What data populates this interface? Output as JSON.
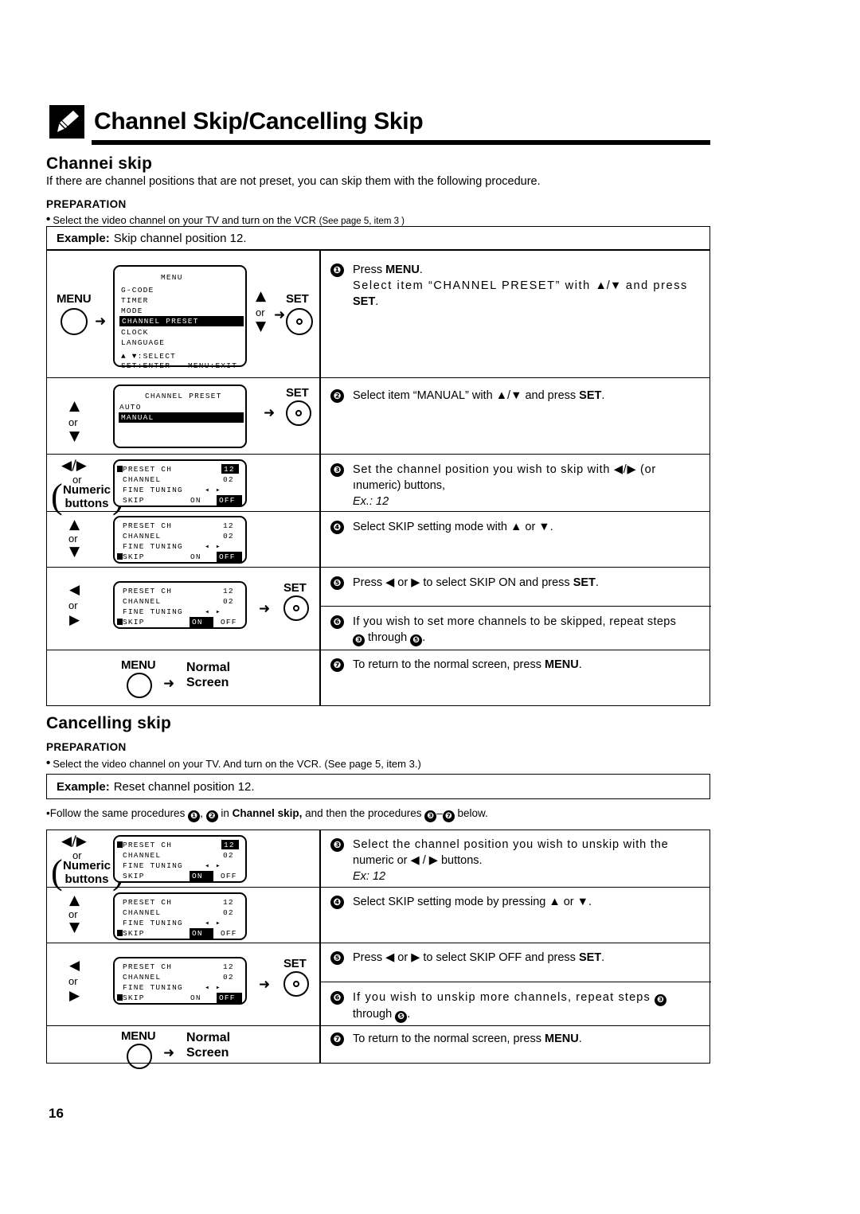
{
  "page": {
    "number": "16",
    "title": "Channel Skip/Cancelling Skip",
    "title_icon": "pen-icon"
  },
  "channel_skip": {
    "heading": "Channei skip",
    "intro": "If there are channel positions that are not preset, you can skip them with the following procedure.",
    "preparation_label": "PREPARATION",
    "preparation_text_a": "Select the video channel on your TV and turn on the VCR ",
    "preparation_text_b": "(See page 5, item 3 )",
    "example_label": "Example:",
    "example_text": "Skip channel position 12.",
    "steps": [
      {
        "num": "❶",
        "line1_a": "Press ",
        "line1_b": "MENU",
        "line1_c": ".",
        "line2_a": "Select item “CHANNEL PRESET” with ",
        "line2_b": "▲/▼",
        "line2_c": " and press",
        "line3_a": "SET",
        "line3_b": "."
      },
      {
        "num": "❷",
        "line1_a": "Select item “MANUAL” with ",
        "line1_b": "▲/▼",
        "line1_c": " and press ",
        "line1_d": "SET",
        "line1_e": "."
      },
      {
        "num": "❸",
        "line1": "Set the channel position you wish to skip with ◀/▶ (or",
        "line2": "ınumeric) buttons,",
        "line3": "Ex.: 12"
      },
      {
        "num": "❹",
        "line1": "Select SKIP setting mode with ▲ or ▼."
      },
      {
        "num": "❺",
        "line1_a": "Press ◀ or ▶ to select SKIP ON and press ",
        "line1_b": "SET",
        "line1_c": "."
      },
      {
        "num": "❻",
        "line1": "If you wish to set more channels to be skipped, repeat steps",
        "line2_a": "",
        "line2_b": " through ",
        "line2_c": "."
      },
      {
        "num": "❼",
        "line1_a": "To return to the normal screen, press ",
        "line1_b": "MENU",
        "line1_c": "."
      }
    ],
    "osd_menu": {
      "title": "MENU",
      "items": [
        "G-CODE",
        "TIMER",
        "MODE",
        "CHANNEL PRESET",
        "CLOCK",
        "LANGUAGE"
      ],
      "highlighted_item": "CHANNEL PRESET",
      "footer_left": "▲ ▼:SELECT",
      "footer_row2_left": "SET:ENTER",
      "footer_row2_right": "MENU:EXIT"
    },
    "osd_preset": {
      "title": "CHANNEL PRESET",
      "items": [
        "AUTO",
        "MANUAL"
      ],
      "highlighted_item": "MANUAL"
    },
    "osd_step3": {
      "rows": [
        {
          "label": "PRESET CH",
          "value": "12",
          "value_highlighted": true
        },
        {
          "label": "CHANNEL",
          "value": "02",
          "value_highlighted": false
        },
        {
          "label": "FINE TUNING",
          "value": "◂  ▸",
          "value_highlighted": false
        }
      ],
      "skip_label": "SKIP",
      "skip_on": "ON",
      "skip_off": "OFF",
      "skip_selected": "OFF",
      "cursor_on": "preset-ch"
    },
    "osd_step4": {
      "rows": [
        {
          "label": "PRESET CH",
          "value": "12",
          "value_highlighted": false
        },
        {
          "label": "CHANNEL",
          "value": "02",
          "value_highlighted": false
        },
        {
          "label": "FINE TUNING",
          "value": "◂  ▸",
          "value_highlighted": false
        }
      ],
      "skip_label": "SKIP",
      "skip_on": "ON",
      "skip_off": "OFF",
      "skip_selected": "OFF",
      "cursor_on": "skip"
    },
    "osd_step5": {
      "rows": [
        {
          "label": "PRESET CH",
          "value": "12",
          "value_highlighted": false
        },
        {
          "label": "CHANNEL",
          "value": "02",
          "value_highlighted": false
        },
        {
          "label": "FINE TUNING",
          "value": "◂  ▸",
          "value_highlighted": false
        }
      ],
      "skip_label": "SKIP",
      "skip_on": "ON",
      "skip_off": "OFF",
      "skip_selected": "ON",
      "cursor_on": "skip"
    },
    "buttons": {
      "menu": "MENU",
      "set": "SET",
      "or": "or",
      "up": "▲",
      "down": "▼",
      "left": "◀",
      "right": "▶",
      "leftright": "◀/▶",
      "numeric_line1": "Numeric",
      "numeric_line2": "buttons",
      "normal_line1": "Normal",
      "normal_line2": "Screen",
      "flow_arrow": "➜"
    }
  },
  "cancelling_skip": {
    "heading": "Cancelling skip",
    "preparation_label": "PREPARATION",
    "preparation_text": "Select the video channel on your TV. And turn on the VCR. (See page 5, item 3.)",
    "example_label": "Example:",
    "example_text": "Reset channel position 12.",
    "follow_a": "Follow the same procedures ",
    "follow_b": ", ",
    "follow_c": " in ",
    "follow_d": "Channel skip,",
    "follow_e": " and then the procedures ",
    "follow_f": "–",
    "follow_g": " below.",
    "steps": [
      {
        "num": "❸",
        "line1": "Select the channel position you wish to unskip with the",
        "line2": "numeric or ◀ / ▶ buttons.",
        "line3": "Ex: 12"
      },
      {
        "num": "❹",
        "line1": "Select SKIP setting mode by pressing ▲ or ▼."
      },
      {
        "num": "❺",
        "line1_a": "Press ◀ or ▶ to select SKIP OFF and press ",
        "line1_b": "SET",
        "line1_c": "."
      },
      {
        "num": "❻",
        "line1": "If you wish to unskip more channels, repeat steps",
        "line2_b": "through ",
        "line2_c": "."
      },
      {
        "num": "❼",
        "line1_a": "To return to the normal screen, press ",
        "line1_b": "MENU",
        "line1_c": "."
      }
    ],
    "osd_step3": {
      "rows": [
        {
          "label": "PRESET CH",
          "value": "12",
          "value_highlighted": true
        },
        {
          "label": "CHANNEL",
          "value": "02",
          "value_highlighted": false
        },
        {
          "label": "FINE TUNING",
          "value": "◂  ▸",
          "value_highlighted": false
        }
      ],
      "skip_label": "SKIP",
      "skip_on": "ON",
      "skip_off": "OFF",
      "skip_selected": "ON",
      "cursor_on": "preset-ch"
    },
    "osd_step4": {
      "rows": [
        {
          "label": "PRESET CH",
          "value": "12",
          "value_highlighted": false
        },
        {
          "label": "CHANNEL",
          "value": "02",
          "value_highlighted": false
        },
        {
          "label": "FINE TUNING",
          "value": "◂  ▸",
          "value_highlighted": false
        }
      ],
      "skip_label": "SKIP",
      "skip_on": "ON",
      "skip_off": "OFF",
      "skip_selected": "ON",
      "cursor_on": "skip"
    },
    "osd_step5": {
      "rows": [
        {
          "label": "PRESET CH",
          "value": "12",
          "value_highlighted": false
        },
        {
          "label": "CHANNEL",
          "value": "02",
          "value_highlighted": false
        },
        {
          "label": "FINE TUNING",
          "value": "◂  ▸",
          "value_highlighted": false
        }
      ],
      "skip_label": "SKIP",
      "skip_on": "ON",
      "skip_off": "OFF",
      "skip_selected": "OFF",
      "cursor_on": "skip"
    }
  }
}
